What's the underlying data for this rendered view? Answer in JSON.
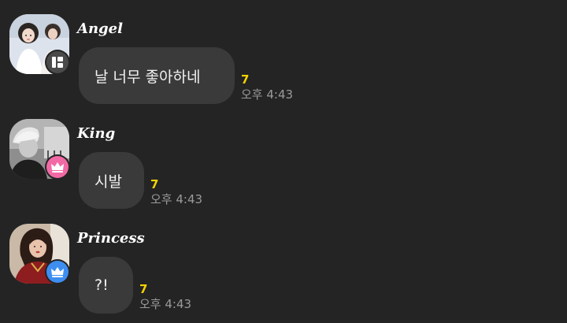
{
  "messages": [
    {
      "sender": "Angel",
      "text": "날 너무 좋아하네",
      "unread": "7",
      "time": "오후 4:43",
      "badge_icon": "grid-icon",
      "badge_color": "#4a4a4a"
    },
    {
      "sender": "King",
      "text": "시발",
      "unread": "7",
      "time": "오후 4:43",
      "badge_icon": "crown-icon",
      "badge_color": "#f26aa5"
    },
    {
      "sender": "Princess",
      "text": "?!",
      "unread": "7",
      "time": "오후 4:43",
      "badge_icon": "crown-icon",
      "badge_color": "#3d8ef0"
    }
  ],
  "colors": {
    "background": "#242424",
    "bubble": "#3a3a3a",
    "unread": "#f2d300",
    "time": "#9a9a9a"
  }
}
